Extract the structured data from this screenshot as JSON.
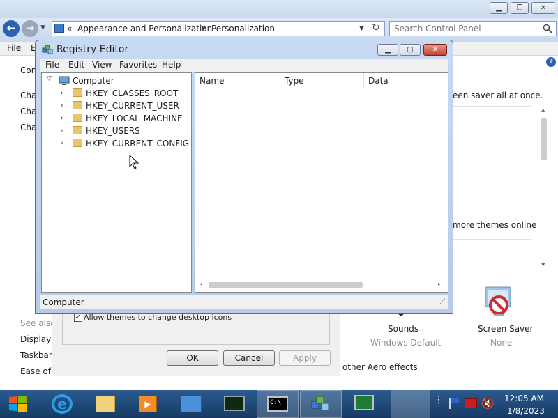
{
  "control_panel": {
    "address": {
      "separator": "«",
      "crumb1": "Appearance and Personalization",
      "crumb2": "Personalization"
    },
    "search": {
      "placeholder": "Search Control Panel"
    },
    "menu": {
      "file": "File",
      "edit_partial": "E"
    },
    "left_links": [
      "Con",
      "Cha",
      "Cha",
      "Cha"
    ],
    "see_also": "See also",
    "see_also_links": [
      "Display",
      "Taskbar a",
      "Ease of A"
    ],
    "screen_saver_text": "een saver all at once.",
    "more_themes": "more themes online",
    "aero_effects": "other Aero effects",
    "sounds": {
      "label": "Sounds",
      "sub": "Windows Default"
    },
    "screen_saver": {
      "label": "Screen Saver",
      "sub": "None"
    }
  },
  "dialog": {
    "checkbox_label": "Allow themes to change desktop icons",
    "ok": "OK",
    "cancel": "Cancel",
    "apply": "Apply"
  },
  "registry_editor": {
    "title": "Registry Editor",
    "menu": [
      "File",
      "Edit",
      "View",
      "Favorites",
      "Help"
    ],
    "tree_root": "Computer",
    "tree_items": [
      "HKEY_CLASSES_ROOT",
      "HKEY_CURRENT_USER",
      "HKEY_LOCAL_MACHINE",
      "HKEY_USERS",
      "HKEY_CURRENT_CONFIG"
    ],
    "columns": [
      "Name",
      "Type",
      "Data"
    ],
    "status": "Computer"
  },
  "taskbar": {
    "time": "12:05 AM",
    "date": "1/8/2023"
  },
  "colors": {
    "accent": "#2a63b0",
    "taskbar": "#1f4a7a"
  }
}
